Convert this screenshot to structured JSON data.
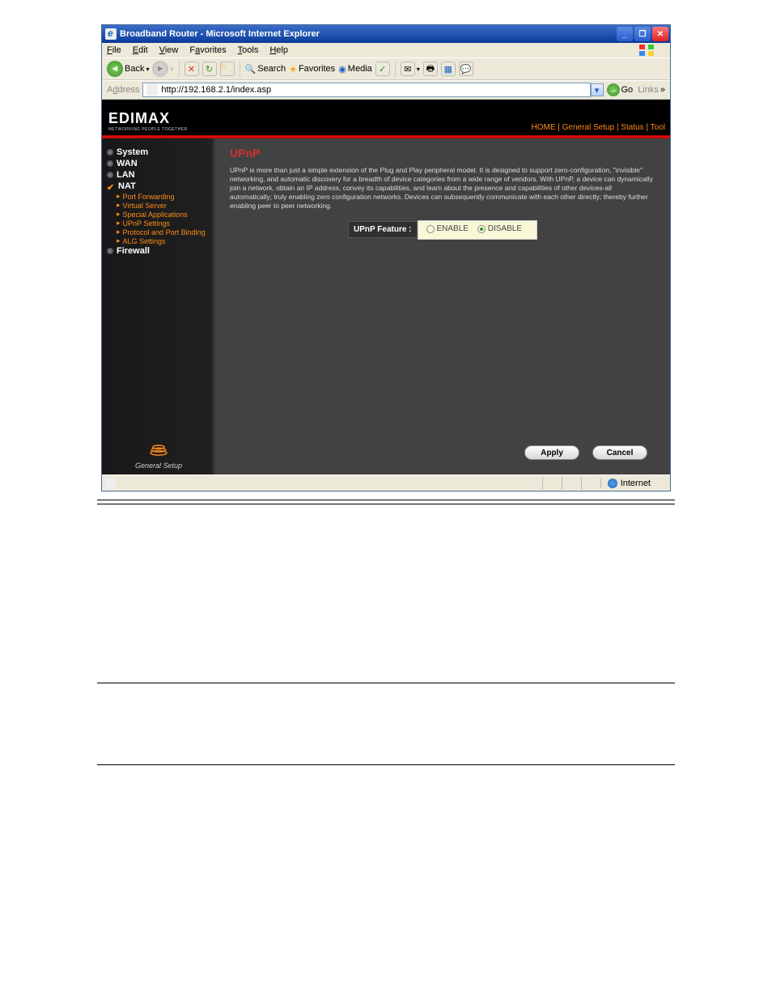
{
  "window": {
    "title": "Broadband Router - Microsoft Internet Explorer"
  },
  "menu": {
    "file": "File",
    "edit": "Edit",
    "view": "View",
    "favorites": "Favorites",
    "tools": "Tools",
    "help": "Help"
  },
  "toolbar": {
    "back": "Back",
    "search": "Search",
    "favorites": "Favorites",
    "media": "Media"
  },
  "addressbar": {
    "label": "Address",
    "url": "http://192.168.2.1/index.asp",
    "go": "Go",
    "links": "Links"
  },
  "brand": {
    "name": "EDIMAX",
    "tag": "NETWORKING PEOPLE TOGETHER"
  },
  "tabs": {
    "home": "HOME",
    "general": "General Setup",
    "status": "Status",
    "tool": "Tool"
  },
  "sidebar": {
    "system": "System",
    "wan": "WAN",
    "lan": "LAN",
    "nat": "NAT",
    "sub": {
      "pf": "Port Forwarding",
      "vs": "Virtual Server",
      "sa": "Special Applications",
      "upnp": "UPnP Settings",
      "ppb": "Protocol and Port Binding",
      "alg": "ALG Settings"
    },
    "firewall": "Firewall",
    "footer": "General Setup"
  },
  "main": {
    "heading": "UPnP",
    "desc": "UPnP is more than just a simple extension of the Plug and Play peripheral model. It is designed to support zero-configuration, \"invisible\" networking, and automatic discovery for a breadth of device categories from a wide range of vendors. With UPnP, a device can dynamically join a network, obtain an IP address, convey its capabilities, and learn about the presence and capabilities of other devices-all automatically; truly enabling zero configuration networks. Devices can subsequently communicate with each other directly; thereby further enabling peer to peer networking.",
    "feature_label": "UPnP Feature :",
    "enable": "ENABLE",
    "disable": "DISABLE",
    "apply": "Apply",
    "cancel": "Cancel"
  },
  "status": {
    "zone": "Internet"
  }
}
